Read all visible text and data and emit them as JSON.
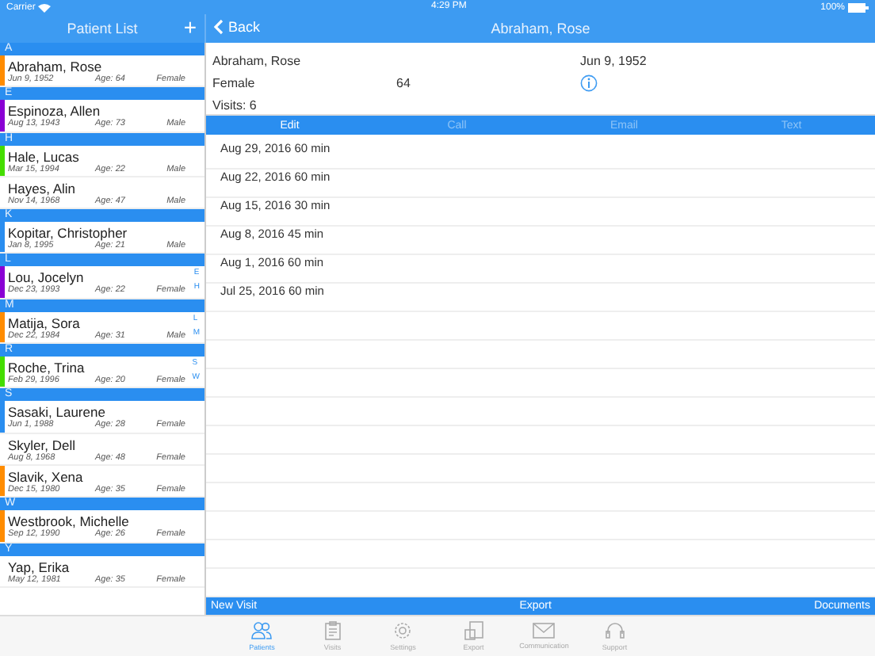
{
  "status_bar": {
    "carrier": "Carrier",
    "time": "4:29 PM",
    "battery": "100%"
  },
  "sidebar": {
    "title": "Patient List",
    "add_button": "+",
    "sections": [
      {
        "letter": "A",
        "patients": [
          {
            "name": "Abraham, Rose",
            "dob": "Jun 9, 1952",
            "age": "Age: 64",
            "sex": "Female",
            "color": "#ff8c00"
          }
        ]
      },
      {
        "letter": "E",
        "patients": [
          {
            "name": "Espinoza, Allen",
            "dob": "Aug 13, 1943",
            "age": "Age: 73",
            "sex": "Male",
            "color": "#8a00d4"
          }
        ]
      },
      {
        "letter": "H",
        "patients": [
          {
            "name": "Hale, Lucas",
            "dob": "Mar 15, 1994",
            "age": "Age: 22",
            "sex": "Male",
            "color": "#44dd00"
          },
          {
            "name": "Hayes, Alin",
            "dob": "Nov 14, 1968",
            "age": "Age: 47",
            "sex": "Male"
          }
        ]
      },
      {
        "letter": "K",
        "patients": [
          {
            "name": "Kopitar, Christopher",
            "dob": "Jan 8, 1995",
            "age": "Age: 21",
            "sex": "Male",
            "color": "#2a8ef0"
          }
        ]
      },
      {
        "letter": "L",
        "patients": [
          {
            "name": "Lou, Jocelyn",
            "dob": "Dec 23, 1993",
            "age": "Age: 22",
            "sex": "Female",
            "color": "#8a00d4",
            "index_letters": [
              "E",
              "H"
            ]
          }
        ]
      },
      {
        "letter": "M",
        "patients": [
          {
            "name": "Matija, Sora",
            "dob": "Dec 22, 1984",
            "age": "Age: 31",
            "sex": "Male",
            "color": "#ff8c00",
            "index_letters": [
              "L",
              "M"
            ]
          }
        ]
      },
      {
        "letter": "R",
        "patients": [
          {
            "name": "Roche, Trina",
            "dob": "Feb 29, 1996",
            "age": "Age: 20",
            "sex": "Female",
            "color": "#44dd00",
            "index_letters": [
              "S",
              "W"
            ]
          }
        ]
      },
      {
        "letter": "S",
        "patients": [
          {
            "name": "Sasaki, Laurene",
            "dob": "Jun 1, 1988",
            "age": "Age: 28",
            "sex": "Female",
            "color": "#2a8ef0"
          },
          {
            "name": "Skyler, Dell",
            "dob": "Aug 8, 1968",
            "age": "Age: 48",
            "sex": "Female"
          },
          {
            "name": "Slavik, Xena",
            "dob": "Dec 15, 1980",
            "age": "Age: 35",
            "sex": "Female",
            "color": "#ff8c00"
          }
        ]
      },
      {
        "letter": "W",
        "patients": [
          {
            "name": "Westbrook, Michelle",
            "dob": "Sep 12, 1990",
            "age": "Age: 26",
            "sex": "Female",
            "color": "#ff8c00"
          }
        ]
      },
      {
        "letter": "Y",
        "patients": [
          {
            "name": "Yap, Erika",
            "dob": "May 12, 1981",
            "age": "Age: 35",
            "sex": "Female"
          }
        ]
      }
    ]
  },
  "detail": {
    "back": "Back",
    "title": "Abraham, Rose",
    "name": "Abraham, Rose",
    "dob": "Jun 9, 1952",
    "sex": "Female",
    "age": "64",
    "visits": "Visits: 6",
    "actions": [
      {
        "label": "Edit",
        "selected": true
      },
      {
        "label": "Call",
        "selected": false
      },
      {
        "label": "Email",
        "selected": false
      },
      {
        "label": "Text",
        "selected": false
      }
    ],
    "visit_rows": [
      "Aug 29, 2016  60 min",
      "Aug 22, 2016  60 min",
      "Aug 15, 2016  30 min",
      "Aug 8, 2016  45 min",
      "Aug 1, 2016  60 min",
      "Jul 25, 2016  60 min"
    ],
    "bottom_bar": {
      "left": "New Visit",
      "center": "Export",
      "right": "Documents"
    }
  },
  "tab_bar": [
    {
      "kind": "patients",
      "label": "Patients",
      "selected": true
    },
    {
      "kind": "visits",
      "label": "Visits",
      "selected": false
    },
    {
      "kind": "settings",
      "label": "Settings",
      "selected": false
    },
    {
      "kind": "export",
      "label": "Export",
      "selected": false
    },
    {
      "kind": "communication",
      "label": "Communication",
      "selected": false
    },
    {
      "kind": "support",
      "label": "Support",
      "selected": false
    }
  ]
}
